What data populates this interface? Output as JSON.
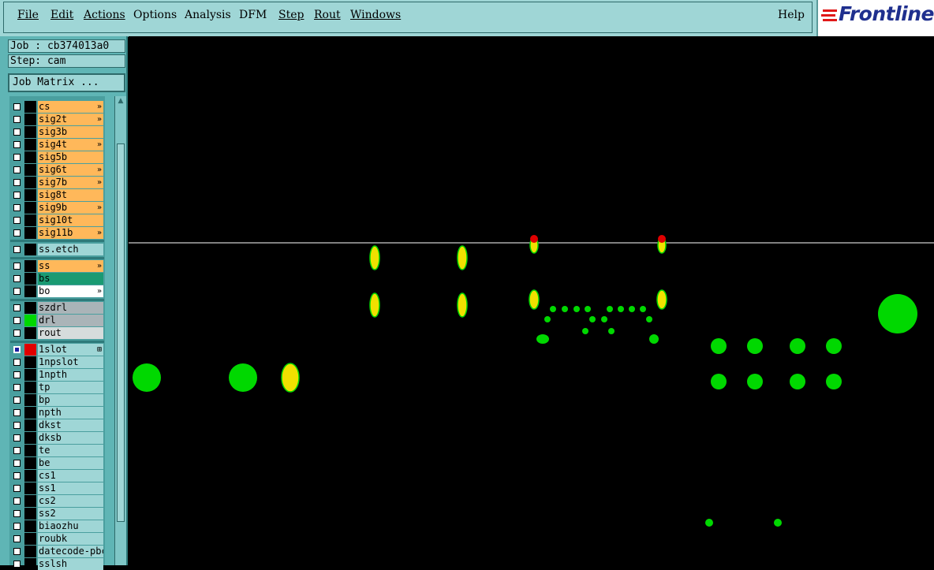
{
  "menu": {
    "items": [
      "File",
      "Edit",
      "Actions",
      "Options",
      "Analysis",
      "DFM",
      "Step",
      "Rout",
      "Windows"
    ],
    "help": "Help",
    "logo": "Frontline"
  },
  "job": {
    "job_label": "Job : cb374013a0",
    "step_label": "Step: cam",
    "matrix_button": "Job Matrix ..."
  },
  "colors": {
    "board_layer": "#ffb85a",
    "soldermask_selected": "#1a9a72",
    "drill_gray": "#aab4b8",
    "rout_light": "#d6dcdc",
    "layer_blue": "#9fd6d6",
    "pad_yellow": "#f0e000",
    "pad_green": "#00d800",
    "pad_red": "#e00000"
  },
  "layers": [
    {
      "name": "cs",
      "flag": "»",
      "kind": "board"
    },
    {
      "name": "sig2t",
      "flag": "»",
      "kind": "board"
    },
    {
      "name": "sig3b",
      "flag": "",
      "kind": "board"
    },
    {
      "name": "sig4t",
      "flag": "»",
      "kind": "board"
    },
    {
      "name": "sig5b",
      "flag": "",
      "kind": "board"
    },
    {
      "name": "sig6t",
      "flag": "»",
      "kind": "board"
    },
    {
      "name": "sig7b",
      "flag": "»",
      "kind": "board"
    },
    {
      "name": "sig8t",
      "flag": "",
      "kind": "board"
    },
    {
      "name": "sig9b",
      "flag": "»",
      "kind": "board"
    },
    {
      "name": "sig10t",
      "flag": "",
      "kind": "board"
    },
    {
      "name": "sig11b",
      "flag": "»",
      "kind": "board"
    },
    {
      "name": "ss.etch",
      "flag": "",
      "kind": "misc"
    },
    {
      "name": "ss",
      "flag": "»",
      "kind": "board"
    },
    {
      "name": "bs",
      "flag": "",
      "kind": "mask"
    },
    {
      "name": "bo",
      "flag": "»",
      "kind": "white"
    },
    {
      "name": "szdrl",
      "flag": "",
      "kind": "drill"
    },
    {
      "name": "drl",
      "flag": "",
      "kind": "drill",
      "swatch": "green"
    },
    {
      "name": "rout",
      "flag": "",
      "kind": "rout"
    },
    {
      "name": "1slot",
      "flag": "⊞",
      "kind": "misc",
      "swatch": "red",
      "selected": true
    },
    {
      "name": "1npslot",
      "flag": "",
      "kind": "misc"
    },
    {
      "name": "1npth",
      "flag": "",
      "kind": "misc"
    },
    {
      "name": "tp",
      "flag": "",
      "kind": "misc"
    },
    {
      "name": "bp",
      "flag": "",
      "kind": "misc"
    },
    {
      "name": "npth",
      "flag": "",
      "kind": "misc"
    },
    {
      "name": "dkst",
      "flag": "",
      "kind": "misc"
    },
    {
      "name": "dksb",
      "flag": "",
      "kind": "misc"
    },
    {
      "name": "te",
      "flag": "",
      "kind": "misc"
    },
    {
      "name": "be",
      "flag": "",
      "kind": "misc"
    },
    {
      "name": "cs1",
      "flag": "",
      "kind": "misc"
    },
    {
      "name": "ss1",
      "flag": "",
      "kind": "misc"
    },
    {
      "name": "cs2",
      "flag": "",
      "kind": "misc"
    },
    {
      "name": "ss2",
      "flag": "",
      "kind": "misc"
    },
    {
      "name": "biaozhu",
      "flag": "",
      "kind": "misc"
    },
    {
      "name": "roubk",
      "flag": "",
      "kind": "misc"
    },
    {
      "name": "datecode-pbc",
      "flag": "",
      "kind": "misc"
    },
    {
      "name": "sslsh",
      "flag": "",
      "kind": "misc"
    }
  ]
}
